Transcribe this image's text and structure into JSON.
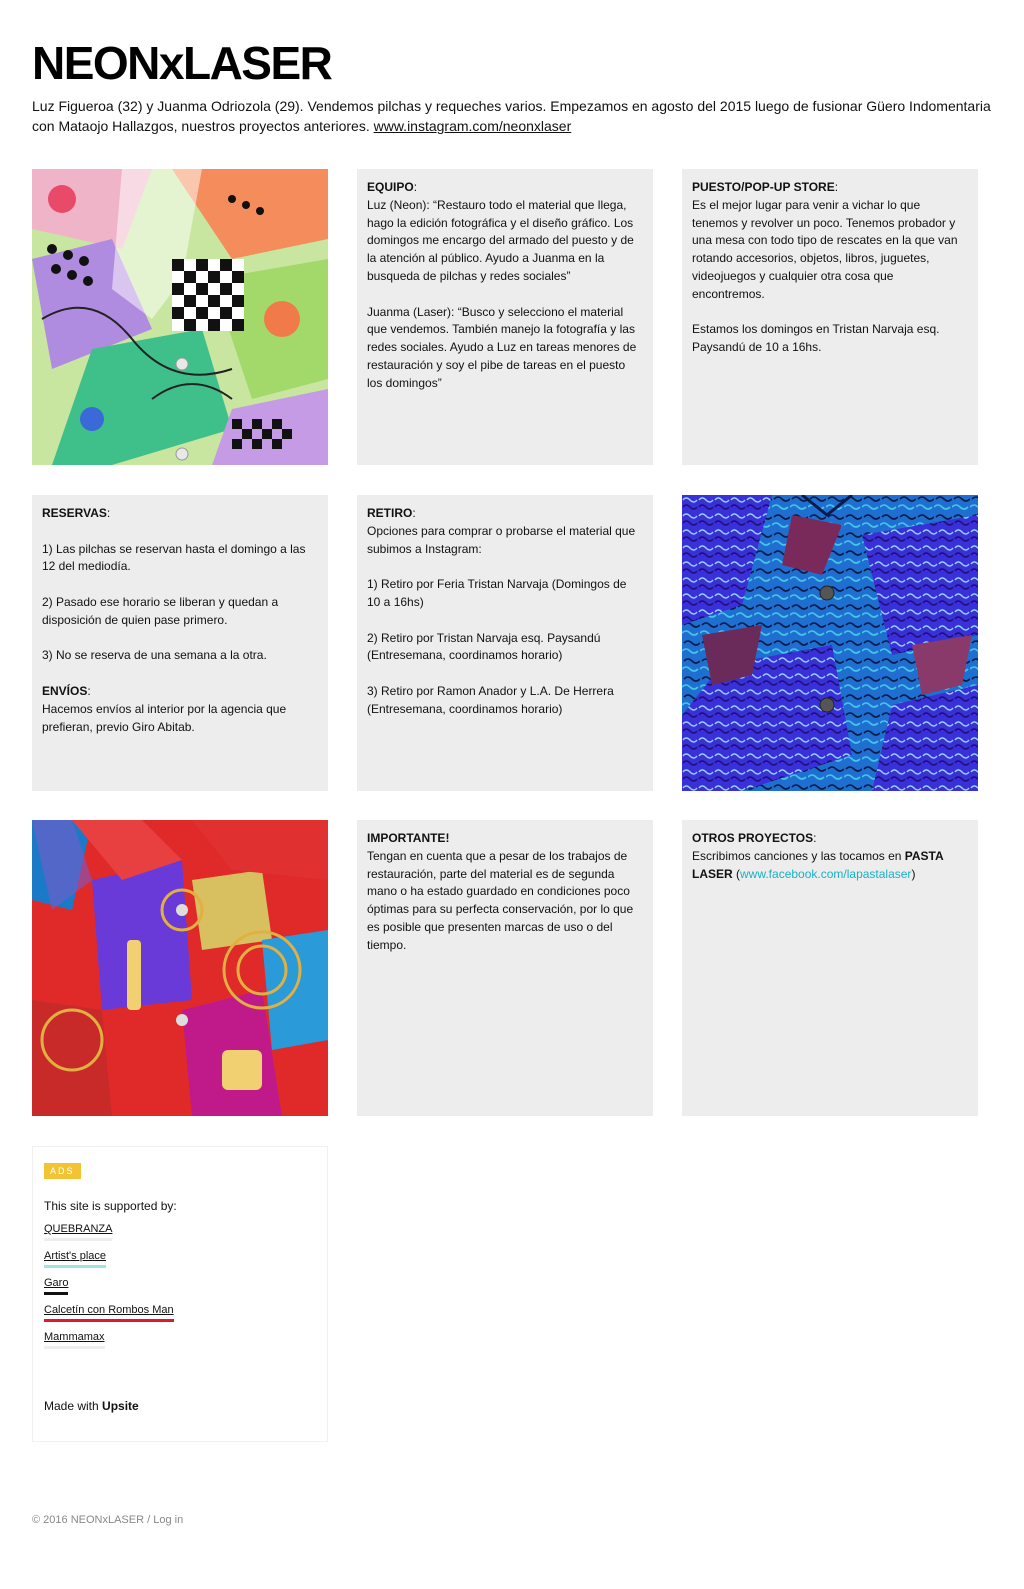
{
  "header": {
    "title": "NEONxLASER",
    "intro": "Luz Figueroa (32) y Juanma Odriozola (29). Vendemos pilchas y requeches varios. Empezamos en agosto del 2015 luego de fusionar Güero Indomentaria con Mataojo Hallazgos, nuestros proyectos anteriores.",
    "instagram_link": "www.instagram.com/neonxlaser"
  },
  "equipo": {
    "heading": "EQUIPO",
    "luz": " Luz (Neon): “Restauro todo el material que llega, hago la edición fotográfica y el diseño gráfico. Los domingos me encargo del armado del puesto y de la atención al público. Ayudo a Juanma en la busqueda de pilchas y redes sociales”",
    "juanma": " Juanma (Laser): “Busco y selecciono el material que vendemos. También manejo la fotografía y las redes sociales. Ayudo a Luz en tareas menores de restauración y soy el pibe de tareas en el puesto los domingos”"
  },
  "puesto": {
    "heading": "PUESTO/POP-UP STORE",
    "p1": "Es el mejor lugar para venir a vichar lo que tenemos y revolver un poco. Tenemos probador y una mesa con todo tipo de rescates en la que van rotando accesorios, objetos, libros, juguetes, videojuegos y cualquier otra cosa que encontremos.",
    "p2": "Estamos los domingos en Tristan Narvaja esq. Paysandú de 10 a 16hs."
  },
  "reservas": {
    "heading": "RESERVAS",
    "p1": "1) Las pilchas se reservan hasta el domingo a las 12 del mediodía.",
    "p2": "2) Pasado ese horario se liberan y quedan a disposición de quien pase primero.",
    "p3": "3) No se reserva de una semana a la otra.",
    "envios_heading": "ENVÍOS",
    "envios_text": "Hacemos envíos al interior por la agencia que prefieran, previo Giro Abitab."
  },
  "retiro": {
    "heading": "RETIRO",
    "intro": "Opciones para comprar o probarse el material que subimos a Instagram:",
    "p1": "1) Retiro por Feria Tristan Narvaja (Domingos de 10 a 16hs)",
    "p2": "2) Retiro por Tristan Narvaja esq. Paysandú (Entresemana, coordinamos horario)",
    "p3": "3) Retiro por Ramon Anador y L.A. De Herrera (Entresemana, coordinamos horario)"
  },
  "importante": {
    "heading": "IMPORTANTE!",
    "text": "Tengan en cuenta que a pesar de los trabajos de restauración, parte del material es de segunda mano o ha estado guardado en condiciones poco óptimas para su perfecta conservación, por lo que es posible que presenten marcas de uso o del tiempo."
  },
  "otros": {
    "heading": "OTROS PROYECTOS",
    "text_before": "Escribimos canciones y las tocamos en ",
    "band": "PASTA LASER",
    "paren_open": " (",
    "link": "www.facebook.com/lapastalaser",
    "paren_close": ")"
  },
  "ads": {
    "badge": "ADS",
    "supported_by": "This site is supported by:",
    "sponsors": [
      {
        "name": "QUEBRANZA",
        "color": "#eeeeee"
      },
      {
        "name": "Artist's place",
        "color": "#9fe3e3"
      },
      {
        "name": "Garo",
        "color": "#111111"
      },
      {
        "name": "Calcetín con Rombos Man",
        "color": "#e0182d"
      },
      {
        "name": "Mammamax",
        "color": "#eeeeee"
      }
    ],
    "made_with": "Made with ",
    "made_with_brand": "Upsite"
  },
  "footer": {
    "copyright": "© 2016 NEONxLASER",
    "separator": " / ",
    "login": "Log in"
  }
}
